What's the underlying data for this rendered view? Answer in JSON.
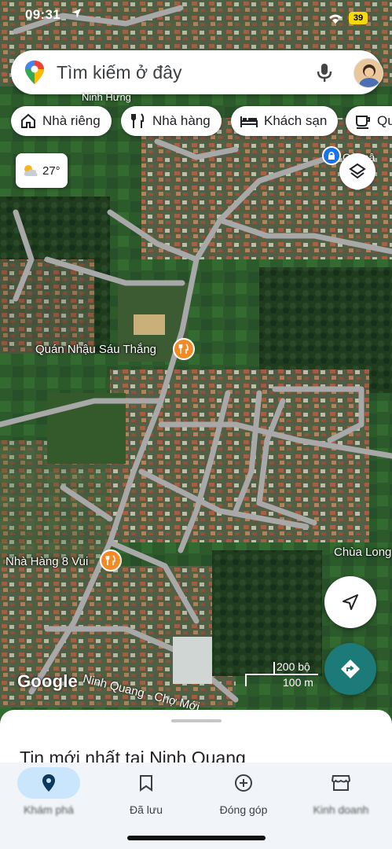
{
  "status_bar": {
    "time": "09:31",
    "battery": "39",
    "icons": [
      "location-arrow-icon",
      "wifi-icon",
      "battery-icon"
    ]
  },
  "search": {
    "placeholder": "Tìm kiếm ở đây"
  },
  "chips": [
    {
      "label": "Nhà riêng",
      "icon": "home-icon"
    },
    {
      "label": "Nhà hàng",
      "icon": "fork-knife-icon"
    },
    {
      "label": "Khách sạn",
      "icon": "bed-icon"
    },
    {
      "label": "Qu",
      "icon": "coffee-icon"
    }
  ],
  "weather": {
    "temp": "27°",
    "icon": "partly-cloudy-icon"
  },
  "map": {
    "top_label": "Ninh Hưng",
    "edge_label": "Cả mâ",
    "places": [
      {
        "name": "Quán Nhậu Sáu Thắng",
        "icon": "restaurant-pin-icon"
      },
      {
        "name": "Nhà Hàng 8 Vui",
        "icon": "restaurant-pin-icon"
      },
      {
        "name": "Chùa Long"
      }
    ],
    "road": "Ninh Quang - Chợ Mới",
    "scale": {
      "imperial": "200 bộ",
      "metric": "100 m"
    },
    "attribution": "Google"
  },
  "sheet": {
    "title": "Tin mới nhất tại Ninh Quang"
  },
  "nav": [
    {
      "label": "Khám phá",
      "icon": "explore-pin-icon",
      "active": true,
      "obscured": true
    },
    {
      "label": "Đã lưu",
      "icon": "bookmark-icon",
      "active": false,
      "obscured": false
    },
    {
      "label": "Đóng góp",
      "icon": "add-circle-icon",
      "active": false,
      "obscured": false
    },
    {
      "label": "Kinh doanh",
      "icon": "store-icon",
      "active": false,
      "obscured": true
    }
  ],
  "colors": {
    "accent": "#1a73e8",
    "directions_fab": "#1c7a78",
    "pin": "#f28b25",
    "nav_active": "#c9e6fc"
  }
}
